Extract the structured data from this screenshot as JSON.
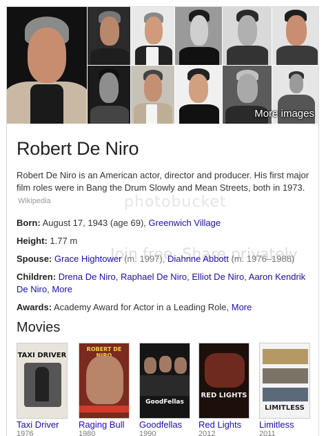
{
  "grid": {
    "more_images_label": "More images"
  },
  "person": {
    "name": "Robert De Niro",
    "description": "Robert De Niro is an American actor, director and producer. His first major film roles were in Bang the Drum Slowly and Mean Streets, both in 1973.",
    "description_source": "Wikipedia"
  },
  "facts": {
    "born": {
      "label": "Born:",
      "text": "August 17, 1943 (age 69),",
      "link": "Greenwich Village"
    },
    "height": {
      "label": "Height:",
      "value": "1.77 m"
    },
    "spouse": {
      "label": "Spouse:",
      "link1": "Grace Hightower",
      "note1": "(m. 1997),",
      "link2": "Diahnne Abbott",
      "note2": "(m. 1976–1988)"
    },
    "children": {
      "label": "Children:",
      "link1": "Drena De Niro",
      "sep1": ",",
      "link2": "Raphael De Niro",
      "sep2": ",",
      "link3": "Elliot De Niro",
      "sep3": ",",
      "link4": "Aaron Kendrik De Niro",
      "sep4": ",",
      "more": "More"
    },
    "awards": {
      "label": "Awards:",
      "text": "Academy Award for Actor in a Leading Role,",
      "more": "More"
    }
  },
  "movies": {
    "heading": "Movies",
    "items": [
      {
        "title": "Taxi Driver",
        "year": "1976",
        "poster_text": "TAXI DRIVER"
      },
      {
        "title": "Raging Bull",
        "year": "1980",
        "poster_text": "ROBERT DE NIRO"
      },
      {
        "title": "Goodfellas",
        "year": "1990",
        "poster_text": "GoodFellas"
      },
      {
        "title": "Red Lights",
        "year": "2012",
        "poster_text": "RED LIGHTS"
      },
      {
        "title": "Limitless",
        "year": "2011",
        "poster_text": "LIMITLESS"
      }
    ]
  },
  "watermark": {
    "line1": "photobucket",
    "line2": "Join free. Share privately"
  }
}
